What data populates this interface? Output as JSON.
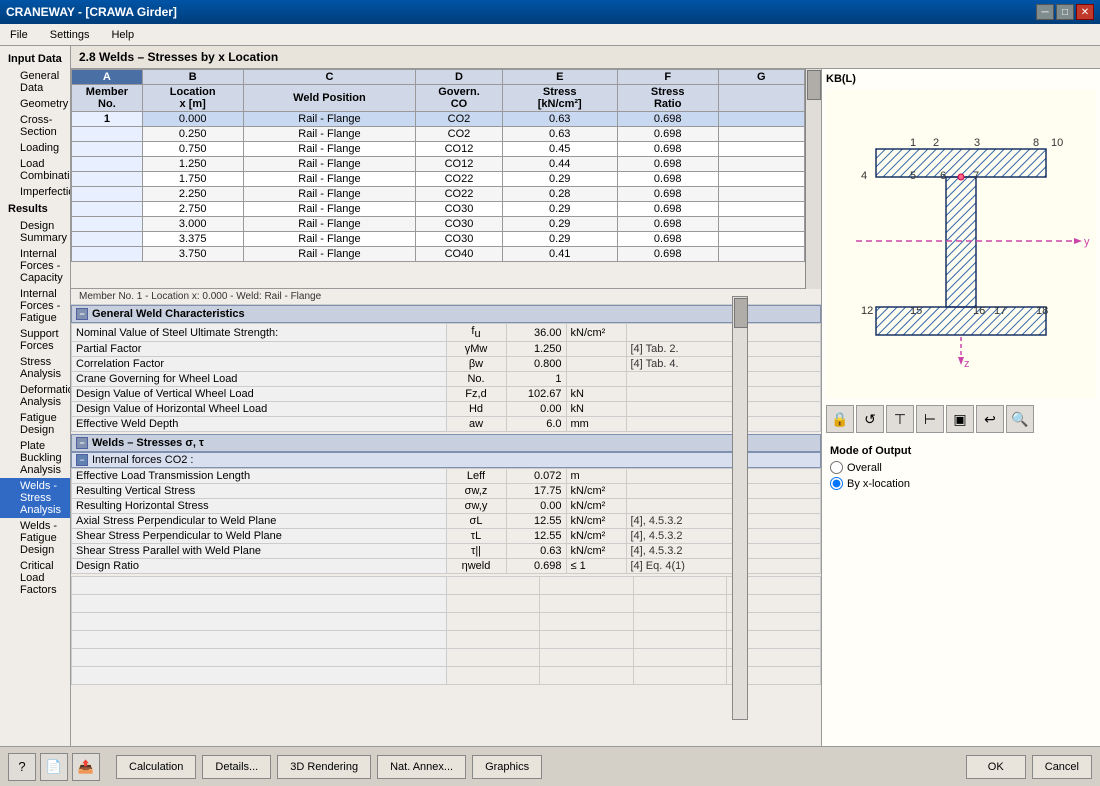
{
  "window": {
    "title": "CRANEWAY - [CRAWA Girder]",
    "close_label": "✕",
    "min_label": "─",
    "max_label": "□"
  },
  "menu": {
    "items": [
      "File",
      "Settings",
      "Help"
    ]
  },
  "sidebar": {
    "input_data_label": "Input Data",
    "items_input": [
      {
        "label": "General Data",
        "id": "general-data"
      },
      {
        "label": "Geometry",
        "id": "geometry"
      },
      {
        "label": "Cross-Section",
        "id": "cross-section"
      },
      {
        "label": "Loading",
        "id": "loading"
      },
      {
        "label": "Load Combinations",
        "id": "load-combinations"
      },
      {
        "label": "Imperfections",
        "id": "imperfections"
      }
    ],
    "results_label": "Results",
    "items_results": [
      {
        "label": "Design Summary",
        "id": "design-summary"
      },
      {
        "label": "Internal Forces - Capacity",
        "id": "internal-forces-capacity"
      },
      {
        "label": "Internal Forces - Fatigue",
        "id": "internal-forces-fatigue"
      },
      {
        "label": "Support Forces",
        "id": "support-forces"
      },
      {
        "label": "Stress Analysis",
        "id": "stress-analysis"
      },
      {
        "label": "Deformation Analysis",
        "id": "deformation-analysis"
      },
      {
        "label": "Fatigue Design",
        "id": "fatigue-design"
      },
      {
        "label": "Plate Buckling Analysis",
        "id": "plate-buckling-analysis"
      },
      {
        "label": "Welds - Stress Analysis",
        "id": "welds-stress-analysis",
        "active": true
      },
      {
        "label": "Welds - Fatigue Design",
        "id": "welds-fatigue-design"
      },
      {
        "label": "Critical Load Factors",
        "id": "critical-load-factors"
      }
    ]
  },
  "content": {
    "title": "2.8 Welds – Stresses by x Location",
    "location_bar": "Member No. 1  - Location x:  0.000  - Weld: Rail - Flange"
  },
  "table": {
    "columns": [
      "A",
      "B",
      "C",
      "D",
      "E",
      "F",
      "G"
    ],
    "headers_row1": [
      "Member",
      "Location",
      "Weld Position",
      "Govern.",
      "Stress",
      "Stress",
      ""
    ],
    "headers_row2": [
      "No.",
      "x [m]",
      "",
      "CO",
      "[kN/cm²]",
      "Ratio",
      ""
    ],
    "rows": [
      {
        "member": "1",
        "location": "0.000",
        "position": "Rail - Flange",
        "co": "CO2",
        "stress": "0.63",
        "ratio": "0.698",
        "g": ""
      },
      {
        "member": "",
        "location": "0.250",
        "position": "Rail - Flange",
        "co": "CO2",
        "stress": "0.63",
        "ratio": "0.698",
        "g": ""
      },
      {
        "member": "",
        "location": "0.750",
        "position": "Rail - Flange",
        "co": "CO12",
        "stress": "0.45",
        "ratio": "0.698",
        "g": ""
      },
      {
        "member": "",
        "location": "1.250",
        "position": "Rail - Flange",
        "co": "CO12",
        "stress": "0.44",
        "ratio": "0.698",
        "g": ""
      },
      {
        "member": "",
        "location": "1.750",
        "position": "Rail - Flange",
        "co": "CO22",
        "stress": "0.29",
        "ratio": "0.698",
        "g": ""
      },
      {
        "member": "",
        "location": "2.250",
        "position": "Rail - Flange",
        "co": "CO22",
        "stress": "0.28",
        "ratio": "0.698",
        "g": ""
      },
      {
        "member": "",
        "location": "2.750",
        "position": "Rail - Flange",
        "co": "CO30",
        "stress": "0.29",
        "ratio": "0.698",
        "g": ""
      },
      {
        "member": "",
        "location": "3.000",
        "position": "Rail - Flange",
        "co": "CO30",
        "stress": "0.29",
        "ratio": "0.698",
        "g": ""
      },
      {
        "member": "",
        "location": "3.375",
        "position": "Rail - Flange",
        "co": "CO30",
        "stress": "0.29",
        "ratio": "0.698",
        "g": ""
      },
      {
        "member": "",
        "location": "3.750",
        "position": "Rail - Flange",
        "co": "CO40",
        "stress": "0.41",
        "ratio": "0.698",
        "g": ""
      }
    ]
  },
  "general_weld": {
    "section_title": "General Weld Characteristics",
    "rows": [
      {
        "label": "Nominal Value of Steel Ultimate Strength:",
        "symbol": "fu",
        "value": "36.00",
        "unit": "kN/cm²",
        "ref": ""
      },
      {
        "label": "Partial Factor",
        "symbol": "γMw",
        "value": "1.250",
        "unit": "",
        "ref": "[4] Tab. 2."
      },
      {
        "label": "Correlation Factor",
        "symbol": "βw",
        "value": "0.800",
        "unit": "",
        "ref": "[4] Tab. 4."
      },
      {
        "label": "Crane Governing for Wheel Load",
        "symbol": "No.",
        "value": "1",
        "unit": "",
        "ref": ""
      },
      {
        "label": "Design Value of Vertical Wheel Load",
        "symbol": "Fz,d",
        "value": "102.67",
        "unit": "kN",
        "ref": ""
      },
      {
        "label": "Design Value of Horizontal Wheel Load",
        "symbol": "Hd",
        "value": "0.00",
        "unit": "kN",
        "ref": ""
      },
      {
        "label": "Effective Weld Depth",
        "symbol": "aw",
        "value": "6.0",
        "unit": "mm",
        "ref": ""
      }
    ]
  },
  "welds_stresses": {
    "section_title": "Welds – Stresses σ, τ",
    "sub_section_title": "Internal forces CO2 :",
    "rows": [
      {
        "label": "Effective Load Transmission Length",
        "symbol": "Leff",
        "value": "0.072",
        "unit": "m",
        "ref": ""
      },
      {
        "label": "Resulting Vertical Stress",
        "symbol": "σw,z",
        "value": "17.75",
        "unit": "kN/cm²",
        "ref": ""
      },
      {
        "label": "Resulting Horizontal Stress",
        "symbol": "σw,y",
        "value": "0.00",
        "unit": "kN/cm²",
        "ref": ""
      },
      {
        "label": "Axial Stress Perpendicular to Weld Plane",
        "symbol": "σL",
        "value": "12.55",
        "unit": "kN/cm²",
        "ref": "[4], 4.5.3.2"
      },
      {
        "label": "Shear Stress Perpendicular to Weld Plane",
        "symbol": "τL",
        "value": "12.55",
        "unit": "kN/cm²",
        "ref": "[4], 4.5.3.2"
      },
      {
        "label": "Shear Stress Parallel with Weld Plane",
        "symbol": "τ||",
        "value": "0.63",
        "unit": "kN/cm²",
        "ref": "[4], 4.5.3.2"
      },
      {
        "label": "Design Ratio",
        "symbol": "ηweld",
        "value": "0.698",
        "unit": "≤ 1",
        "ref": "[4] Eq. 4(1)"
      }
    ]
  },
  "right_panel": {
    "label": "KB(L)",
    "toolbar_icons": [
      "🔒",
      "🔄",
      "📐",
      "📏",
      "📋",
      "↩",
      "🔍"
    ],
    "mode_label": "Mode of Output",
    "mode_options": [
      {
        "label": "Overall",
        "value": "overall"
      },
      {
        "label": "By x-location",
        "value": "by-x",
        "selected": true
      }
    ]
  },
  "bottom_bar": {
    "icon_btns": [
      "?",
      "📄",
      "📤"
    ],
    "buttons": [
      {
        "label": "Calculation",
        "id": "calc-btn"
      },
      {
        "label": "Details...",
        "id": "details-btn"
      },
      {
        "label": "3D Rendering",
        "id": "3d-btn"
      },
      {
        "label": "Nat. Annex...",
        "id": "annex-btn"
      },
      {
        "label": "Graphics",
        "id": "graphics-btn"
      }
    ],
    "ok_label": "OK",
    "cancel_label": "Cancel"
  }
}
